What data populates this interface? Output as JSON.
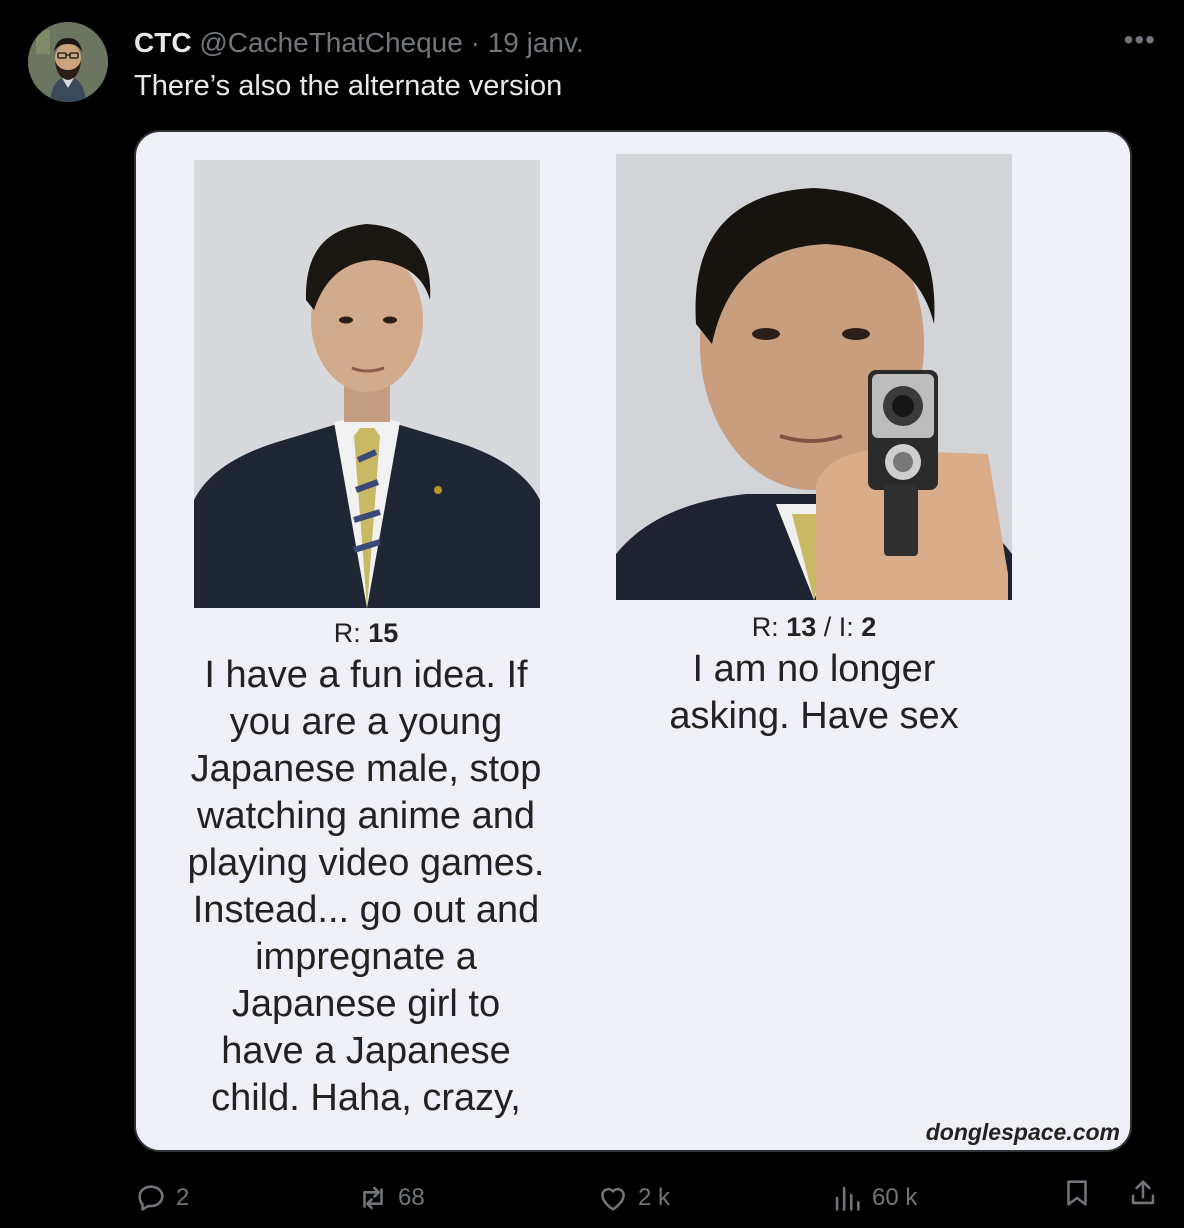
{
  "tweet": {
    "author_name": "CTC",
    "author_handle": "@CacheThatCheque",
    "separator": "·",
    "date": "19 janv.",
    "text": "There’s also the alternate version",
    "more_icon": "more-horizontal-icon"
  },
  "media": {
    "left_panel": {
      "rank_label": "R: ",
      "rank_value": "15",
      "quote_lines": [
        "I have a fun idea. If",
        "you are a young",
        "Japanese male, stop",
        "watching anime and",
        "playing video games.",
        "Instead... go out and",
        "impregnate a",
        "Japanese girl to",
        "have a Japanese",
        "child. Haha, crazy,"
      ]
    },
    "right_panel": {
      "rank_label": "R: ",
      "rank_value": "13",
      "rank_sep": " / I: ",
      "rank_value2": "2",
      "quote_lines": [
        "I am no longer",
        "asking. Have sex"
      ]
    },
    "watermark": "donglespace.com"
  },
  "actions": {
    "reply_count": "2",
    "repost_count": "68",
    "like_count": "2 k",
    "views_count": "60 k"
  },
  "colors": {
    "background": "#000000",
    "text_primary": "#e7e9ea",
    "text_secondary": "#71767b",
    "media_bg": "#eff0f8"
  }
}
